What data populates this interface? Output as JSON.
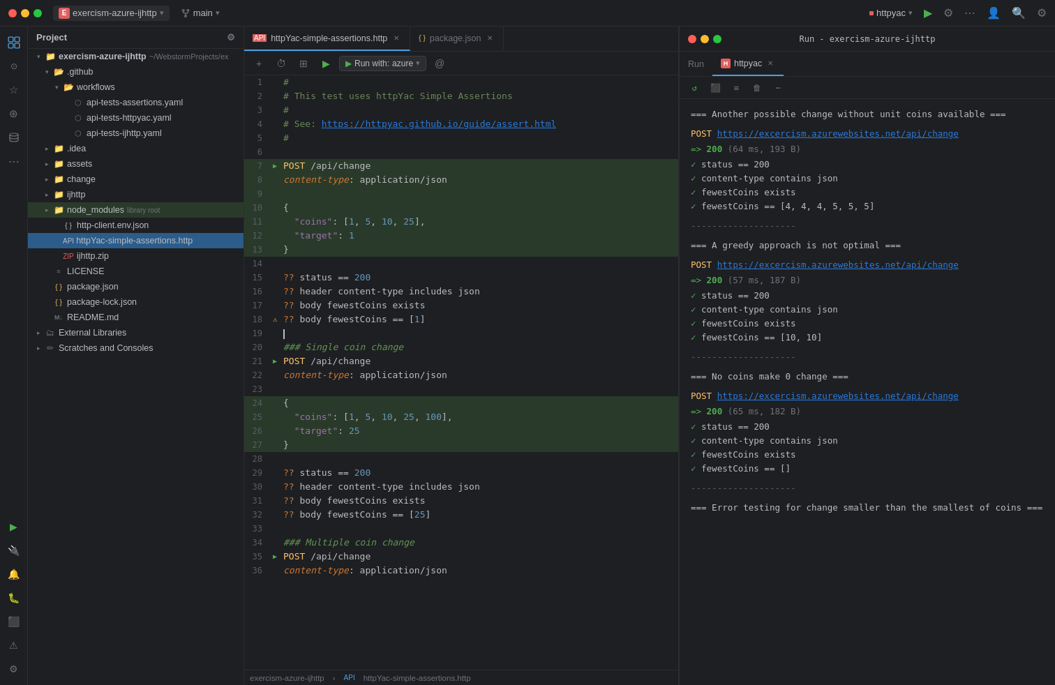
{
  "titlebar": {
    "project_name": "exercism-azure-ijhttp",
    "branch": "main",
    "run_label": "httpyac",
    "dropdown_arrow": "▾"
  },
  "tabs": [
    {
      "label": "httpYac-simple-assertions.http",
      "active": true,
      "icon": "api"
    },
    {
      "label": "package.json",
      "active": false,
      "icon": "json"
    }
  ],
  "editor_toolbar": {
    "run_with_label": "Run with:",
    "run_env": "azure"
  },
  "sidebar": {
    "title": "Project",
    "root": "exercism-azure-ijhttp",
    "root_path": "~/WebstormProjects/ex",
    "items": [
      {
        "label": ".github",
        "type": "folder",
        "indent": 1
      },
      {
        "label": "workflows",
        "type": "folder",
        "indent": 2
      },
      {
        "label": "api-tests-assertions.yaml",
        "type": "file-gh",
        "indent": 3
      },
      {
        "label": "api-tests-httpyac.yaml",
        "type": "file-gh",
        "indent": 3
      },
      {
        "label": "api-tests-ijhttp.yaml",
        "type": "file-gh",
        "indent": 3
      },
      {
        "label": ".idea",
        "type": "folder",
        "indent": 1
      },
      {
        "label": "assets",
        "type": "folder",
        "indent": 1
      },
      {
        "label": "change",
        "type": "folder",
        "indent": 1
      },
      {
        "label": "ijhttp",
        "type": "folder",
        "indent": 1
      },
      {
        "label": "node_modules",
        "type": "folder-lib",
        "indent": 1,
        "badge": "library root"
      },
      {
        "label": "http-client.env.json",
        "type": "file",
        "indent": 2
      },
      {
        "label": "httpYac-simple-assertions.http",
        "type": "file-api",
        "indent": 2,
        "selected": true
      },
      {
        "label": "ijhttp.zip",
        "type": "file-zip",
        "indent": 2
      },
      {
        "label": "LICENSE",
        "type": "file-lic",
        "indent": 1
      },
      {
        "label": "package.json",
        "type": "file-json",
        "indent": 1
      },
      {
        "label": "package-lock.json",
        "type": "file-json",
        "indent": 1
      },
      {
        "label": "README.md",
        "type": "file-md",
        "indent": 1
      },
      {
        "label": "External Libraries",
        "type": "folder",
        "indent": 0
      },
      {
        "label": "Scratches and Consoles",
        "type": "scratches",
        "indent": 0
      }
    ]
  },
  "code_lines": [
    {
      "num": 1,
      "content": "#"
    },
    {
      "num": 2,
      "content": "# This test uses httpYac Simple Assertions"
    },
    {
      "num": 3,
      "content": "#"
    },
    {
      "num": 4,
      "content": "# See: https://httpyac.github.io/guide/assert.html"
    },
    {
      "num": 5,
      "content": "#"
    },
    {
      "num": 6,
      "content": ""
    },
    {
      "num": 7,
      "run": true,
      "content": "POST /api/change",
      "highlight": true
    },
    {
      "num": 8,
      "content": "content-type: application/json",
      "highlight": true
    },
    {
      "num": 9,
      "content": "",
      "highlight": true
    },
    {
      "num": 10,
      "content": "{",
      "highlight": true
    },
    {
      "num": 11,
      "content": "  \"coins\": [1, 5, 10, 25],",
      "highlight": true
    },
    {
      "num": 12,
      "content": "  \"target\": 1",
      "highlight": true
    },
    {
      "num": 13,
      "content": "}",
      "highlight": true
    },
    {
      "num": 14,
      "content": ""
    },
    {
      "num": 15,
      "content": "?? status == 200"
    },
    {
      "num": 16,
      "content": "?? header content-type includes json"
    },
    {
      "num": 17,
      "content": "?? body fewestCoins exists"
    },
    {
      "num": 18,
      "warn": true,
      "content": "?? body fewestCoins == [1]"
    },
    {
      "num": 19,
      "cursor": true,
      "content": ""
    },
    {
      "num": 20,
      "content": "### Single coin change",
      "heading": true
    },
    {
      "num": 21,
      "run": true,
      "content": "POST /api/change"
    },
    {
      "num": 22,
      "content": "content-type: application/json"
    },
    {
      "num": 23,
      "content": ""
    },
    {
      "num": 24,
      "content": "{",
      "highlight": true
    },
    {
      "num": 25,
      "content": "  \"coins\": [1, 5, 10, 25, 100],",
      "highlight": true
    },
    {
      "num": 26,
      "content": "  \"target\": 25",
      "highlight": true
    },
    {
      "num": 27,
      "content": "}",
      "highlight": true
    },
    {
      "num": 28,
      "content": ""
    },
    {
      "num": 29,
      "content": "?? status == 200"
    },
    {
      "num": 30,
      "content": "?? header content-type includes json"
    },
    {
      "num": 31,
      "content": "?? body fewestCoins exists"
    },
    {
      "num": 32,
      "content": "?? body fewestCoins == [25]"
    },
    {
      "num": 33,
      "content": ""
    },
    {
      "num": 34,
      "content": "### Multiple coin change",
      "heading": true
    },
    {
      "num": 35,
      "run": true,
      "content": "POST /api/change"
    },
    {
      "num": 36,
      "content": "content-type: application/json"
    }
  ],
  "run_panel": {
    "title": "Run - exercism-azure-ijhttp",
    "active_tab": "httpyac",
    "output": [
      {
        "type": "section",
        "text": "=== Another possible change without unit coins available ==="
      },
      {
        "type": "post",
        "url": "https://excercism.azurewebsites.net/api/change"
      },
      {
        "type": "response",
        "text": "200",
        "ms": "64 ms",
        "bytes": "193 B"
      },
      {
        "type": "check",
        "text": "status == 200"
      },
      {
        "type": "check",
        "text": "content-type contains json"
      },
      {
        "type": "check",
        "text": "fewestCoins exists"
      },
      {
        "type": "check",
        "text": "fewestCoins == [4, 4, 4, 5, 5, 5]"
      },
      {
        "type": "separator",
        "text": "--------------------"
      },
      {
        "type": "section",
        "text": "=== A greedy approach is not optimal ==="
      },
      {
        "type": "post",
        "url": "https://excercism.azurewebsites.net/api/change"
      },
      {
        "type": "response",
        "text": "200",
        "ms": "57 ms",
        "bytes": "187 B"
      },
      {
        "type": "check",
        "text": "status == 200"
      },
      {
        "type": "check",
        "text": "content-type contains json"
      },
      {
        "type": "check",
        "text": "fewestCoins exists"
      },
      {
        "type": "check",
        "text": "fewestCoins == [10, 10]"
      },
      {
        "type": "separator",
        "text": "--------------------"
      },
      {
        "type": "section",
        "text": "=== No coins make 0 change ==="
      },
      {
        "type": "post",
        "url": "https://excercism.azurewebsites.net/api/change"
      },
      {
        "type": "response",
        "text": "200",
        "ms": "65 ms",
        "bytes": "182 B"
      },
      {
        "type": "check",
        "text": "status == 200"
      },
      {
        "type": "check",
        "text": "content-type contains json"
      },
      {
        "type": "check",
        "text": "fewestCoins exists"
      },
      {
        "type": "check",
        "text": "fewestCoins == []"
      },
      {
        "type": "separator",
        "text": "--------------------"
      },
      {
        "type": "section",
        "text": "=== Error testing for change smaller than the smallest of coins ==="
      }
    ]
  },
  "status_bar": {
    "path": "exercism-azure-ijhttp",
    "separator": "›",
    "file": "httpYac-simple-assertions.http"
  }
}
